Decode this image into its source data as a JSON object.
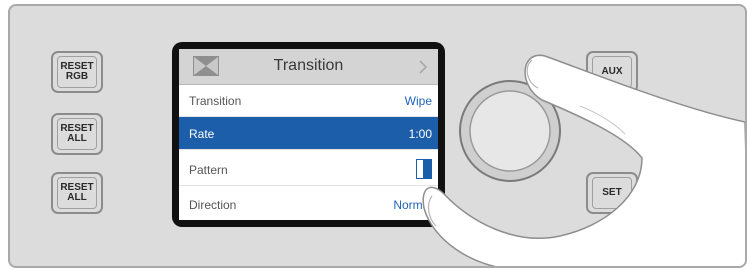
{
  "left_buttons": [
    {
      "label": "RESET\nRGB"
    },
    {
      "label": "RESET\nALL"
    },
    {
      "label": "RESET\nALL"
    }
  ],
  "right_buttons": {
    "aux": "AUX",
    "set": "SET"
  },
  "lcd": {
    "title": "Transition",
    "rows": [
      {
        "label": "Transition",
        "value": "Wipe"
      },
      {
        "label": "Rate",
        "value": "1:00",
        "selected": true
      },
      {
        "label": "Pattern",
        "value_icon": "wipe-pattern-icon"
      },
      {
        "label": "Direction",
        "value": "Normal"
      }
    ]
  },
  "colors": {
    "panel": "#dcdcdc",
    "selection": "#1c5ea9",
    "value_text": "#1f64b8"
  }
}
